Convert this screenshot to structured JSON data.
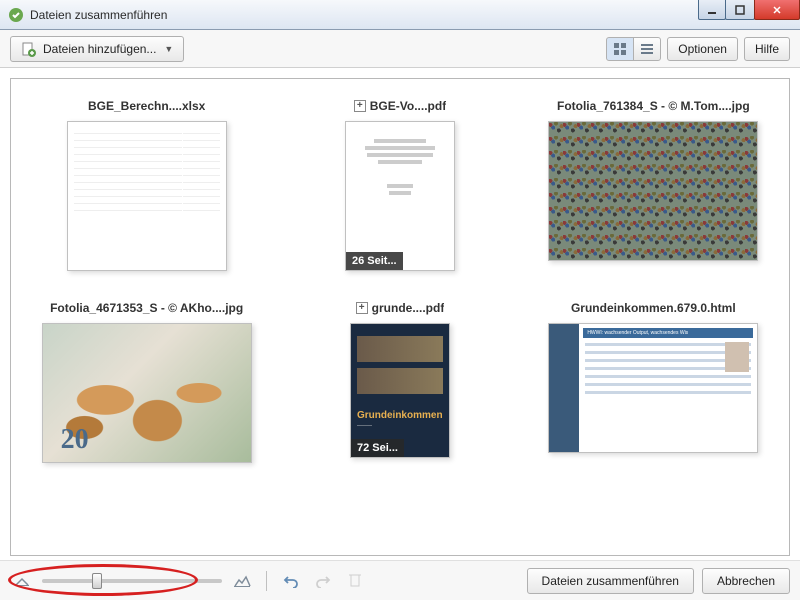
{
  "window": {
    "title": "Dateien zusammenführen"
  },
  "toolbar": {
    "add_files": "Dateien hinzufügen...",
    "options": "Optionen",
    "help": "Hilfe"
  },
  "files": [
    {
      "name": "BGE_Berechn....xlsx",
      "type": "xlsx"
    },
    {
      "name": "BGE-Vo....pdf",
      "type": "pdf",
      "expandable": true,
      "pages_badge": "26 Seit..."
    },
    {
      "name": "Fotolia_761384_S - © M.Tom....jpg",
      "type": "jpg"
    },
    {
      "name": "Fotolia_4671353_S - © AKho....jpg",
      "type": "jpg"
    },
    {
      "name": "grunde....pdf",
      "type": "pdf",
      "expandable": true,
      "pages_badge": "72 Sei...",
      "cover_title": "Grundeinkommen"
    },
    {
      "name": "Grundeinkommen.679.0.html",
      "type": "html",
      "banner": "HWWI: wachsender Output, wachsendes Wis"
    }
  ],
  "buttons": {
    "combine": "Dateien zusammenführen",
    "cancel": "Abbrechen"
  }
}
